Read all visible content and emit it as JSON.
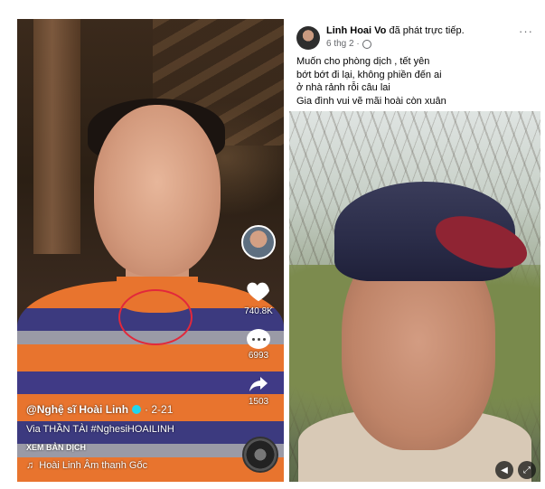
{
  "tiktok": {
    "username": "@Nghệ sĩ Hoài Linh",
    "date": "· 2-21",
    "description": "Via THẦN TÀI #NghesiHOAILINH",
    "translate_label": "XEM BẢN DỊCH",
    "sound": "Hoài Linh Âm thanh Gốc",
    "likes": "740.8K",
    "comments": "6993",
    "shares": "1503",
    "colors": {
      "highlight_circle": "#e2283b",
      "verified": "#20d5ec"
    },
    "icons": [
      "heart-icon",
      "comment-icon",
      "share-icon",
      "music-note-icon",
      "verified-icon"
    ]
  },
  "facebook": {
    "name": "Linh Hoai Vo",
    "action": " đã phát trực tiếp.",
    "time": "6 thg 2 ·",
    "more": "···",
    "lines": [
      "Muốn cho phòng dịch , tết yên",
      "bớt bớt đi lại, không phiền đến ai",
      "ở nhà rảnh rỗi câu lai",
      "Gia đình vui vẽ mãi hoài còn xuân"
    ],
    "icons": [
      "globe-icon",
      "volume-icon",
      "fullscreen-icon"
    ]
  }
}
